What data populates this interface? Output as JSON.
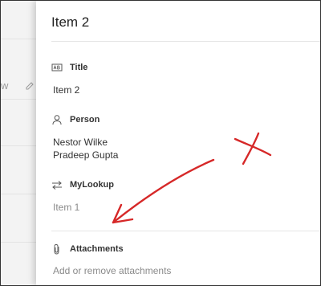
{
  "background": {
    "partial_text": "w"
  },
  "panel": {
    "title": "Item 2",
    "fields": [
      {
        "label": "Title",
        "icon": "text-field-icon",
        "values": [
          "Item 2"
        ]
      },
      {
        "label": "Person",
        "icon": "person-icon",
        "values": [
          "Nestor Wilke",
          "Pradeep Gupta"
        ]
      },
      {
        "label": "MyLookup",
        "icon": "lookup-arrows-icon",
        "values": [
          "Item 1"
        ]
      },
      {
        "label": "Attachments",
        "icon": "paperclip-icon",
        "values": [
          "Add or remove attachments"
        ]
      }
    ]
  },
  "annotation": {
    "color": "#d62828"
  }
}
